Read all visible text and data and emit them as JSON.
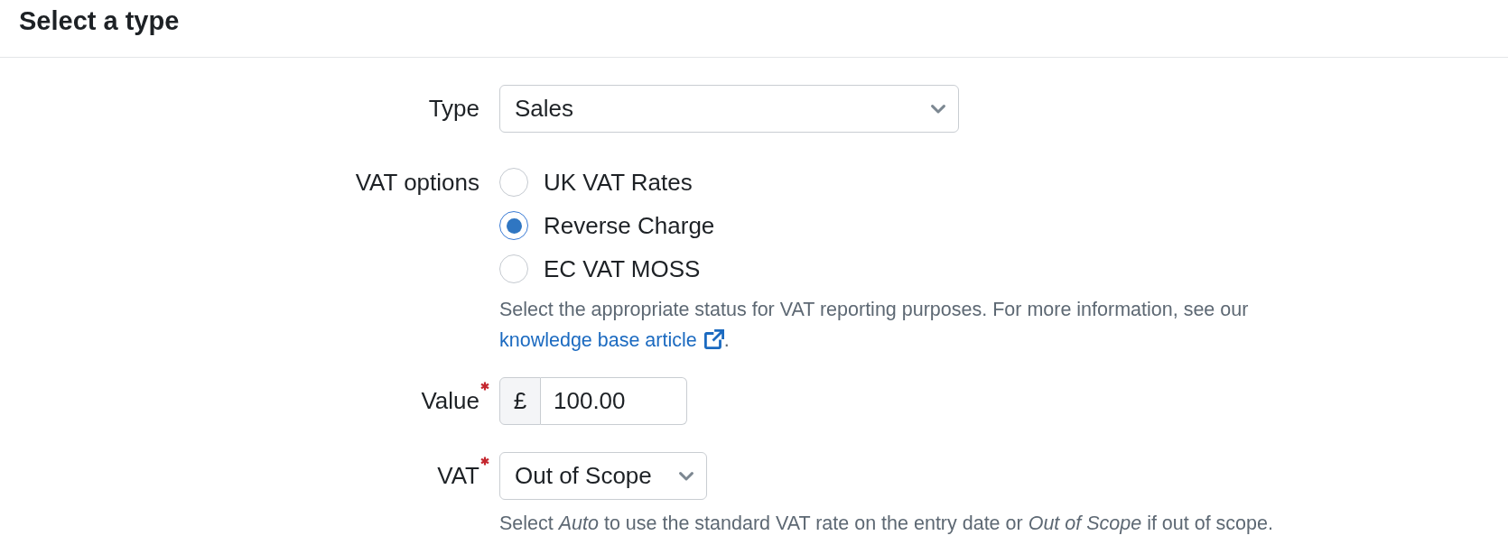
{
  "header": {
    "title": "Select a type"
  },
  "type_field": {
    "label": "Type",
    "value": "Sales"
  },
  "vat_options": {
    "label": "VAT options",
    "options": [
      {
        "label": "UK VAT Rates",
        "selected": false
      },
      {
        "label": "Reverse Charge",
        "selected": true
      },
      {
        "label": "EC VAT MOSS",
        "selected": false
      }
    ],
    "help": {
      "text": "Select the appropriate status for VAT reporting purposes. For more information, see our",
      "link": "knowledge base article",
      "after": "."
    }
  },
  "value_field": {
    "label": "Value",
    "required": true,
    "prefix": "£",
    "value": "100.00"
  },
  "vat_field": {
    "label": "VAT",
    "required": true,
    "value": "Out of Scope",
    "help": "Select *Auto* to use the standard VAT rate on the entry date or *Out of Scope* if out of scope."
  }
}
